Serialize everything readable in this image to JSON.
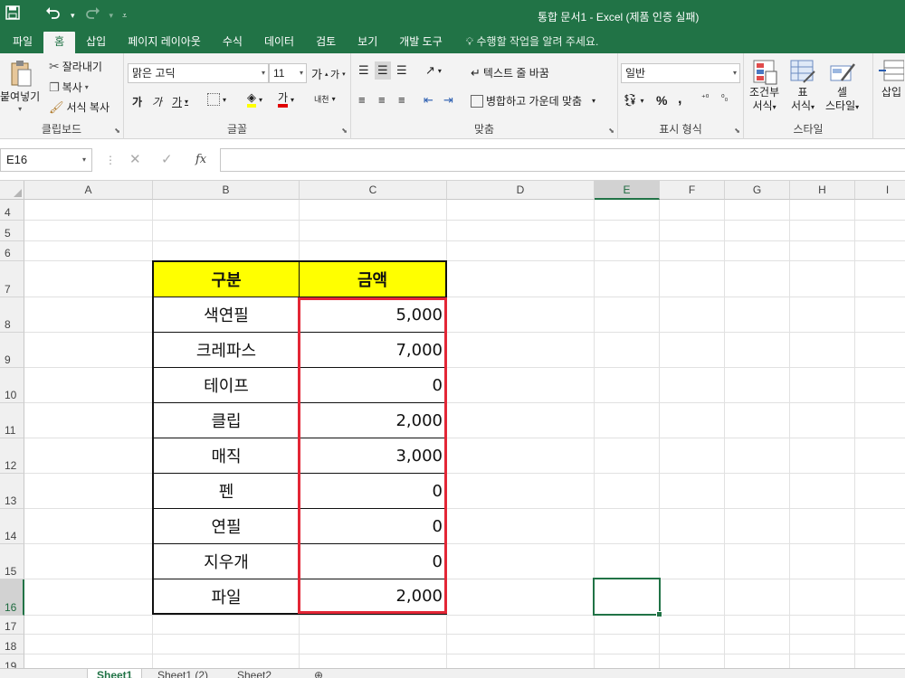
{
  "window": {
    "title": "통합 문서1 - Excel (제품 인증 실패)"
  },
  "qat": {
    "save": "save-icon",
    "undo": "undo-icon",
    "redo": "redo-icon"
  },
  "tabs": [
    "파일",
    "홈",
    "삽입",
    "페이지 레이아웃",
    "수식",
    "데이터",
    "검토",
    "보기",
    "개발 도구"
  ],
  "active_tab": "홈",
  "tell_me": "수행할 작업을 알려 주세요.",
  "ribbon": {
    "clipboard": {
      "label": "클립보드",
      "paste": "붙여넣기",
      "cut": "잘라내기",
      "copy": "복사",
      "format_painter": "서식 복사"
    },
    "font": {
      "label": "글꼴",
      "font_name": "맑은 고딕",
      "font_size": "11",
      "grow": "가",
      "shrink": "가",
      "bold": "가",
      "italic": "가",
      "underline": "가",
      "font_color": "가",
      "phonetic": "내천"
    },
    "alignment": {
      "label": "맞춤",
      "wrap": "텍스트 줄 바꿈",
      "merge": "병합하고 가운데 맞춤"
    },
    "number": {
      "label": "표시 형식",
      "format": "일반",
      "percent": "%",
      "comma": ","
    },
    "styles": {
      "label": "스타일",
      "conditional": "조건부",
      "conditional2": "서식",
      "table": "표",
      "table2": "서식",
      "cell": "셀",
      "cell2": "스타일"
    },
    "cells": {
      "insert": "삽입"
    }
  },
  "formula_bar": {
    "name_box": "E16",
    "cancel": "✕",
    "enter": "✓",
    "fx": "fx",
    "value": ""
  },
  "columns": [
    "A",
    "B",
    "C",
    "D",
    "E",
    "F",
    "G",
    "H",
    "I"
  ],
  "selected_column": "E",
  "rows": [
    "4",
    "5",
    "6",
    "7",
    "8",
    "9",
    "10",
    "11",
    "12",
    "13",
    "14",
    "15",
    "16",
    "17",
    "18",
    "19"
  ],
  "selected_row": "16",
  "table": {
    "headers": [
      "구분",
      "금액"
    ],
    "rows": [
      [
        "색연필",
        "5,000"
      ],
      [
        "크레파스",
        "7,000"
      ],
      [
        "테이프",
        "0"
      ],
      [
        "클립",
        "2,000"
      ],
      [
        "매직",
        "3,000"
      ],
      [
        "펜",
        "0"
      ],
      [
        "연필",
        "0"
      ],
      [
        "지우개",
        "0"
      ],
      [
        "파일",
        "2,000"
      ]
    ]
  },
  "colors": {
    "accent": "#217346",
    "header_fill": "#ffff00",
    "highlight_border": "#e32636"
  },
  "sheets": [
    "Sheet1",
    "Sheet1 (2)",
    "Sheet2"
  ],
  "active_sheet": "Sheet1"
}
